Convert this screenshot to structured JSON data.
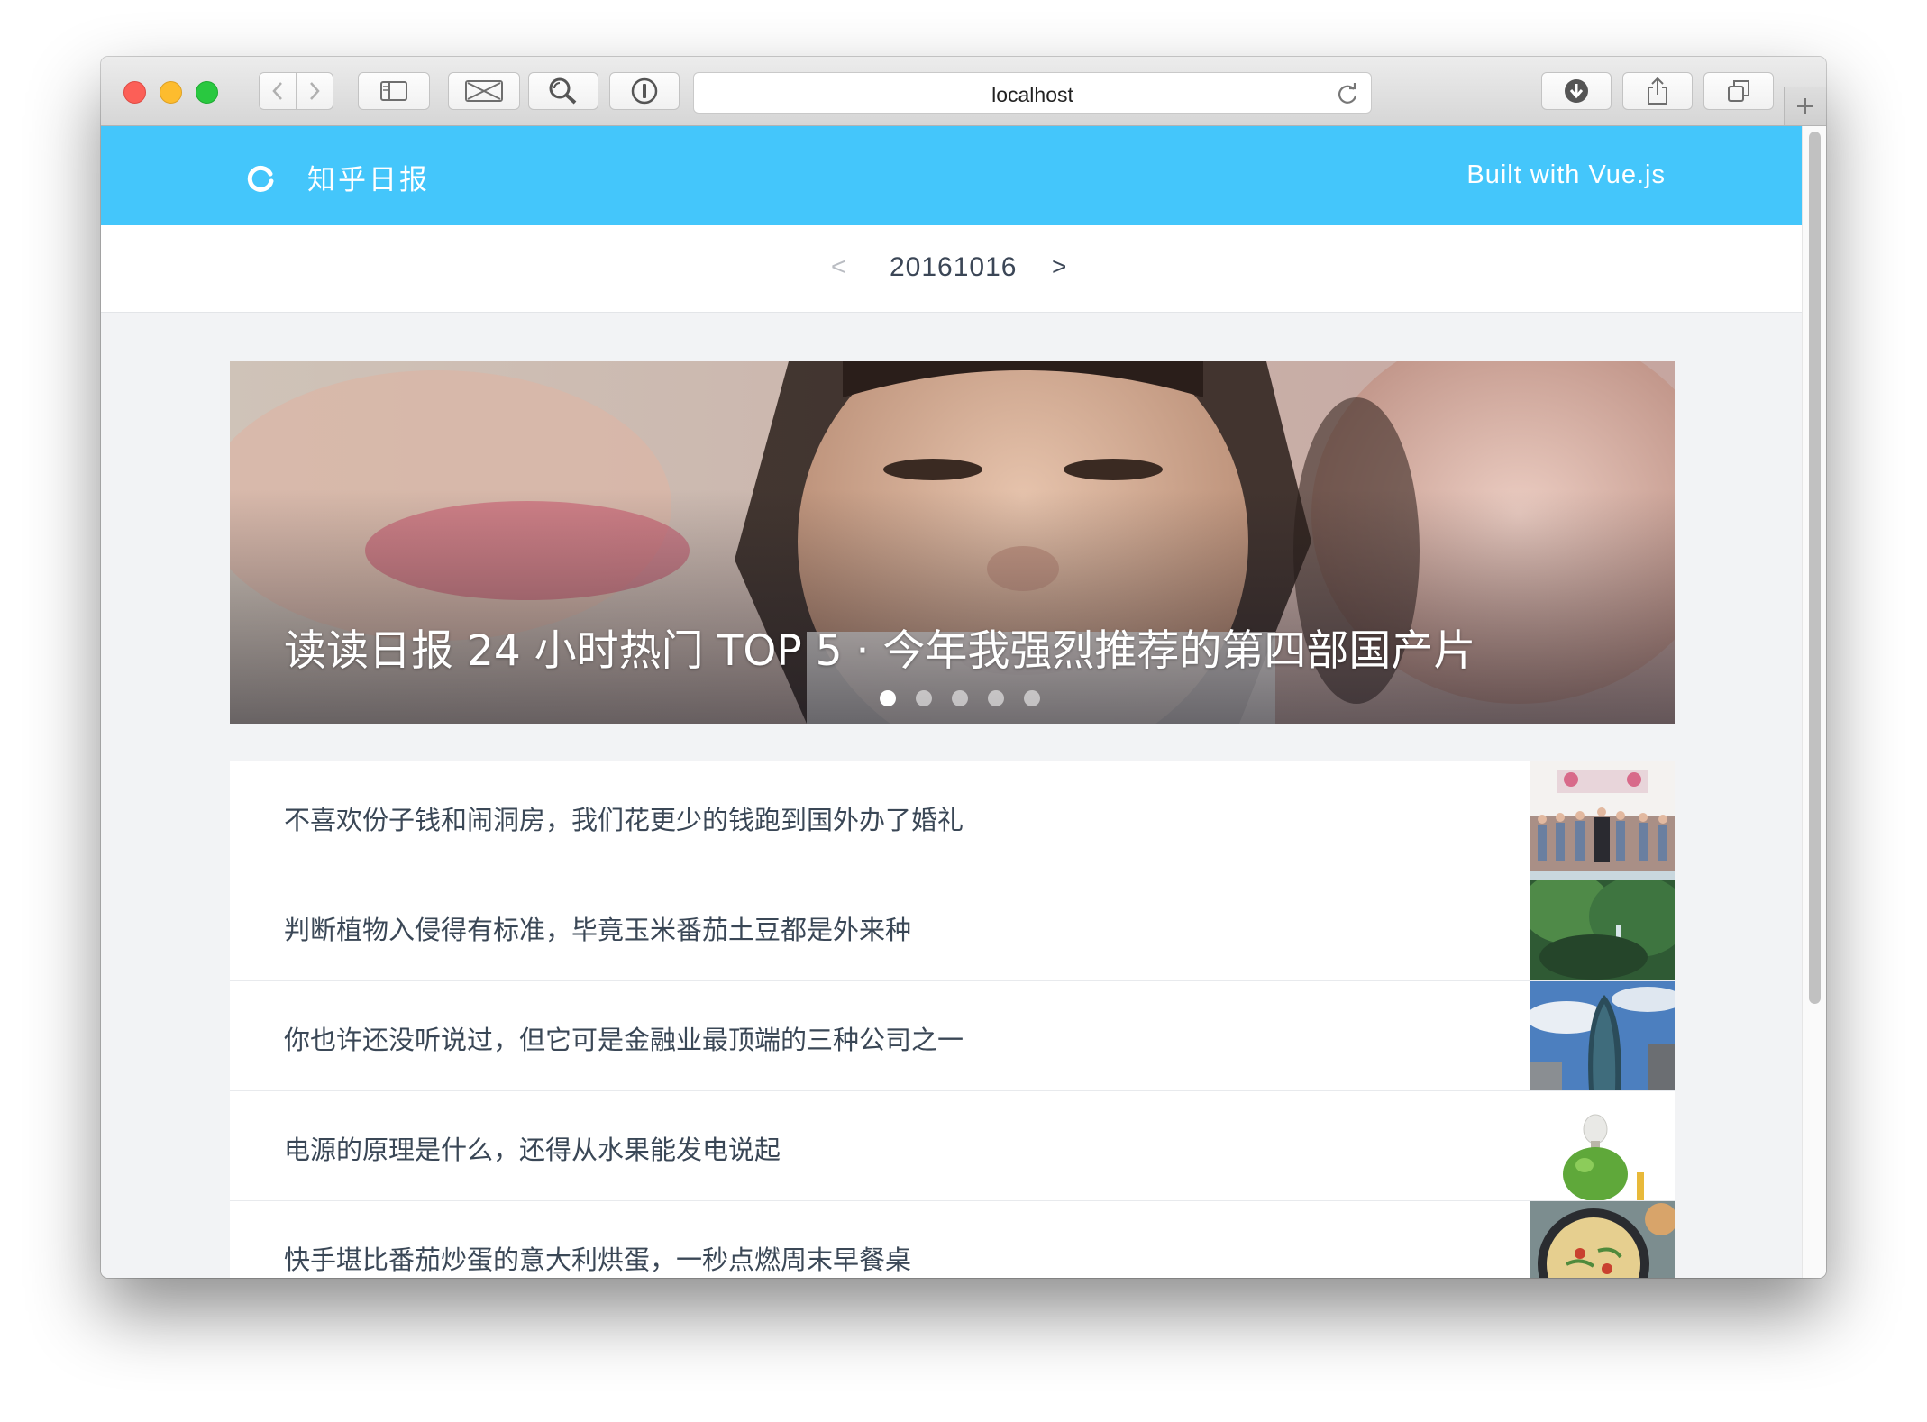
{
  "browser": {
    "url": "localhost"
  },
  "app": {
    "brand": "知乎日报",
    "built_with": "Built with Vue.js"
  },
  "date_nav": {
    "prev_label": "<",
    "date": "20161016",
    "next_label": ">"
  },
  "hero": {
    "title": "读读日报 24 小时热门 TOP 5 · 今年我强烈推荐的第四部国产片",
    "slides": 5,
    "active_slide": 1
  },
  "stories": [
    {
      "title": "不喜欢份子钱和闹洞房，我们花更少的钱跑到国外办了婚礼",
      "thumb": "wedding-photo"
    },
    {
      "title": "判断植物入侵得有标准，毕竟玉米番茄土豆都是外来种",
      "thumb": "waterfall-plants-photo"
    },
    {
      "title": "你也许还没听说过，但它可是金融业最顶端的三种公司之一",
      "thumb": "skyscraper-photo"
    },
    {
      "title": "电源的原理是什么，还得从水果能发电说起",
      "thumb": "apple-bulb-photo"
    },
    {
      "title": "快手堪比番茄炒蛋的意大利烘蛋，一秒点燃周末早餐桌",
      "thumb": "frittata-photo"
    }
  ]
}
